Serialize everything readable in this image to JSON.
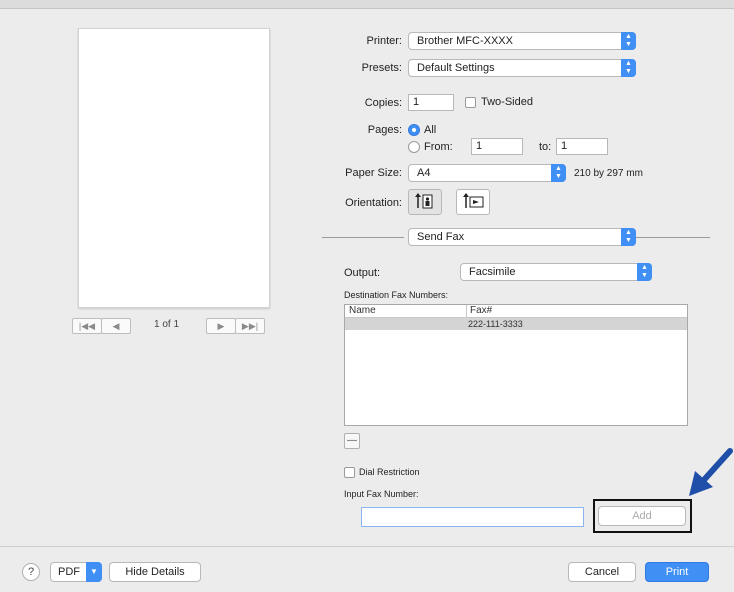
{
  "preview": {
    "first_label": "|◀◀",
    "prev_label": "◀",
    "page_count": "1 of 1",
    "next_label": "▶",
    "last_label": "▶▶|"
  },
  "printer": {
    "label": "Printer:",
    "value": "Brother MFC-XXXX"
  },
  "presets": {
    "label": "Presets:",
    "value": "Default Settings"
  },
  "copies": {
    "label": "Copies:",
    "value": "1",
    "two_sided_label": "Two-Sided"
  },
  "pages": {
    "label": "Pages:",
    "all_label": "All",
    "from_label": "From:",
    "from_value": "1",
    "to_label": "to:",
    "to_value": "1",
    "selected": "All"
  },
  "paper_size": {
    "label": "Paper Size:",
    "value": "A4",
    "dimensions": "210 by 297 mm"
  },
  "orientation": {
    "label": "Orientation:",
    "selected": "portrait"
  },
  "section": {
    "value": "Send Fax"
  },
  "output": {
    "label": "Output:",
    "value": "Facsimile"
  },
  "destination": {
    "label": "Destination Fax Numbers:",
    "columns": [
      "Name",
      "Fax#"
    ],
    "rows": [
      {
        "name": "",
        "fax": "222-111-3333"
      }
    ],
    "remove_label": "—"
  },
  "dial_restriction": {
    "label": "Dial Restriction",
    "checked": false
  },
  "input_fax": {
    "label": "Input Fax Number:",
    "value": "",
    "add_label": "Add"
  },
  "footer": {
    "help_label": "?",
    "pdf_label": "PDF",
    "hide_details_label": "Hide Details",
    "cancel_label": "Cancel",
    "print_label": "Print"
  },
  "colors": {
    "accent": "#3f8ff5",
    "arrow": "#1f4fa8"
  },
  "icons": [
    "stepper-arrows-icon",
    "portrait-icon",
    "landscape-icon",
    "help-icon",
    "callout-arrow-icon"
  ]
}
